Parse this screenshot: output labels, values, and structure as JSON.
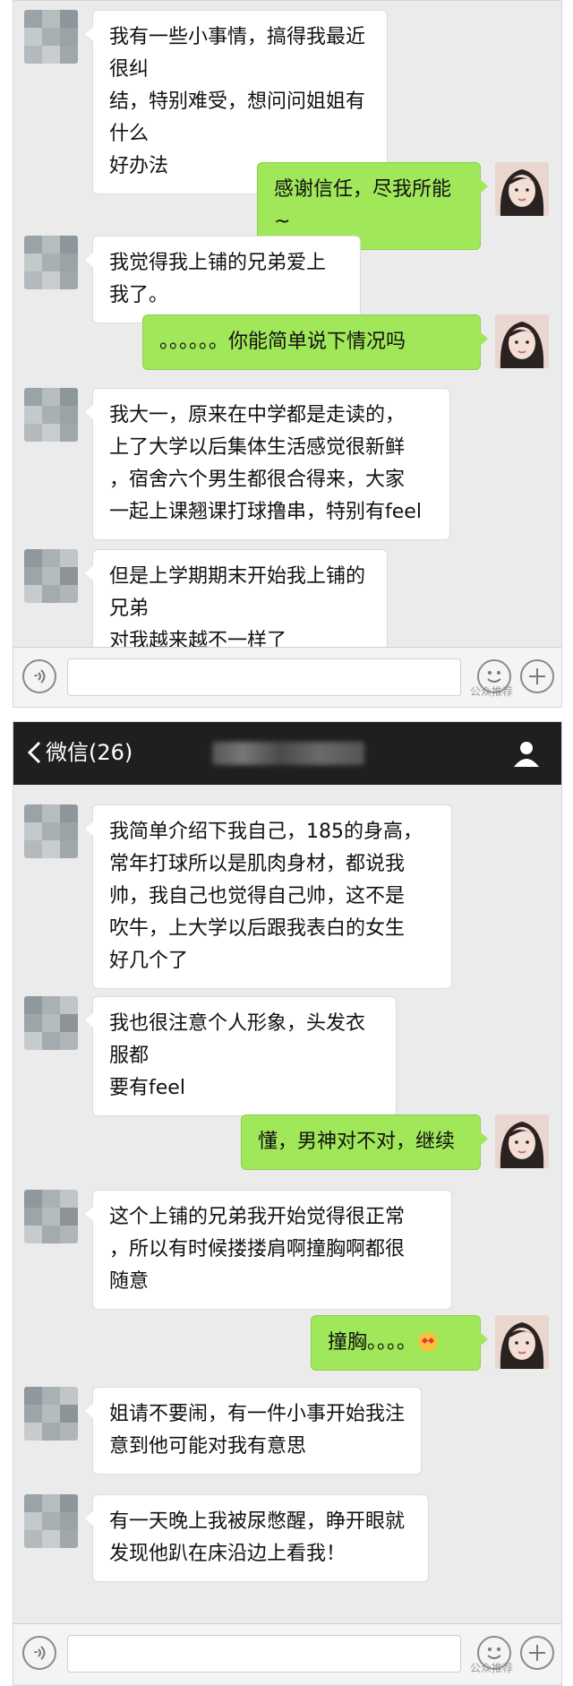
{
  "nav": {
    "back_label": "微信(26)"
  },
  "panel1_messages": [
    {
      "side": "left",
      "text": "我有一些小事情，搞得我最近很纠\n结，特别难受，想问问姐姐有什么\n好办法"
    },
    {
      "side": "right",
      "text": "感谢信任，尽我所能~"
    },
    {
      "side": "left",
      "text": "我觉得我上铺的兄弟爱上我了。"
    },
    {
      "side": "right",
      "text": "。。。。。。你能简单说下情况吗"
    },
    {
      "side": "left",
      "text": "我大一，原来在中学都是走读的，\n上了大学以后集体生活感觉很新鲜\n，宿舍六个男生都很合得来，大家\n一起上课翘课打球撸串，特别有feel"
    },
    {
      "side": "left",
      "text": "但是上学期期末开始我上铺的兄弟\n对我越来越不一样了"
    }
  ],
  "panel2_messages": [
    {
      "side": "left",
      "text": "我简单介绍下我自己，185的身高，\n常年打球所以是肌肉身材，都说我\n帅，我自己也觉得自己帅，这不是\n吹牛，上大学以后跟我表白的女生\n好几个了"
    },
    {
      "side": "left",
      "text": "我也很注意个人形象，头发衣服都\n要有feel"
    },
    {
      "side": "right",
      "text": "懂，男神对不对，继续"
    },
    {
      "side": "left",
      "text": "这个上铺的兄弟我开始觉得很正常\n，所以有时候搂搂肩啊撞胸啊都很\n随意"
    },
    {
      "side": "right",
      "text": "撞胸。。。。",
      "emoji": "blush-emoji"
    },
    {
      "side": "left",
      "text": "姐请不要闹，有一件小事开始我注\n意到他可能对我有意思"
    },
    {
      "side": "left",
      "text": "有一天晚上我被尿憋醒，睁开眼就\n发现他趴在床沿边上看我！"
    }
  ],
  "inputbar": {
    "watermark": "公众推荐"
  },
  "colors": {
    "sent_bubble": "#a0e75a",
    "received_bubble": "#ffffff",
    "chat_bg": "#ebebeb",
    "navbar": "#1f1f1f"
  }
}
